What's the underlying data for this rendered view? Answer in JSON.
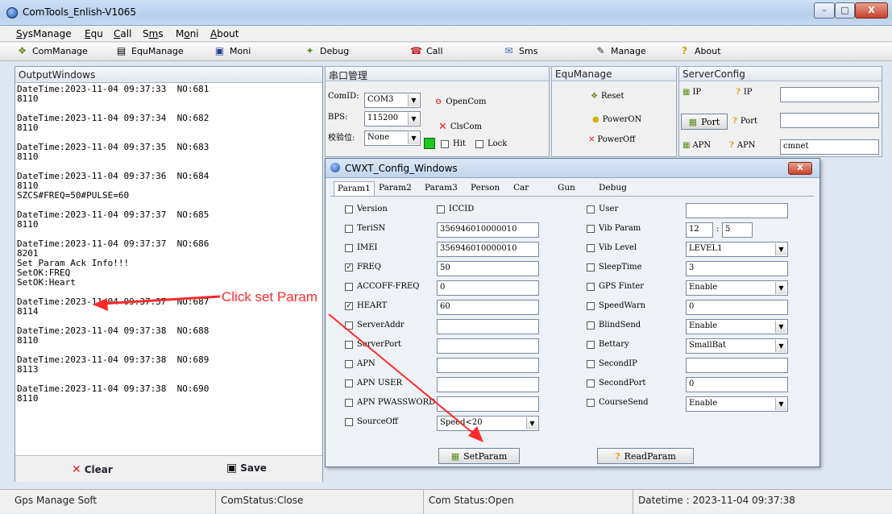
{
  "window": {
    "title": "ComTools_Enlish-V1065",
    "min": "–",
    "max": "□",
    "close": "X"
  },
  "menu": [
    {
      "pre": "",
      "u": "S",
      "post": "ysManage"
    },
    {
      "pre": "",
      "u": "E",
      "post": "qu"
    },
    {
      "pre": "",
      "u": "C",
      "post": "all"
    },
    {
      "pre": "S",
      "u": "m",
      "post": "s"
    },
    {
      "pre": "M",
      "u": "o",
      "post": "ni"
    },
    {
      "pre": "",
      "u": "A",
      "post": "bout"
    }
  ],
  "toolbar": {
    "items": [
      {
        "label": "ComManage",
        "icon": "manage-icon"
      },
      {
        "label": "EquManage",
        "icon": "document-icon"
      },
      {
        "label": "Moni",
        "icon": "monitor-icon"
      },
      {
        "label": "Debug",
        "icon": "debug-icon"
      },
      {
        "label": "Call",
        "icon": "phone-icon"
      },
      {
        "label": "Sms",
        "icon": "sms-icon"
      },
      {
        "label": "Manage",
        "icon": "settings-icon"
      },
      {
        "label": "About",
        "icon": "help-icon"
      }
    ]
  },
  "output": {
    "title": "OutputWindows",
    "lines": [
      "DateTime:2023-11-04 09:37:33  NO:681",
      "8110",
      "",
      "DateTime:2023-11-04 09:37:34  NO:682",
      "8110",
      "",
      "DateTime:2023-11-04 09:37:35  NO:683",
      "8110",
      "",
      "DateTime:2023-11-04 09:37:36  NO:684",
      "8110",
      "SZCS#FREQ=50#PULSE=60",
      "",
      "DateTime:2023-11-04 09:37:37  NO:685",
      "8110",
      "",
      "DateTime:2023-11-04 09:37:37  NO:686",
      "8201",
      "Set Param Ack Info!!!",
      "SetOK:FREQ",
      "SetOK:Heart",
      "",
      "DateTime:2023-11-04 09:37:37  NO:687",
      "8114",
      "",
      "DateTime:2023-11-04 09:37:38  NO:688",
      "8110",
      "",
      "DateTime:2023-11-04 09:37:38  NO:689",
      "8113",
      "",
      "DateTime:2023-11-04 09:37:38  NO:690",
      "8110"
    ],
    "clear": "Clear",
    "save": "Save"
  },
  "serial": {
    "title": "串口管理",
    "comid_label": "ComID:",
    "comid": "COM3",
    "bps_label": "BPS:",
    "bps": "115200",
    "check_label": "校验位:",
    "check": "None",
    "open": "OpenCom",
    "close": "ClsCom",
    "hit": "Hit",
    "lock": "Lock"
  },
  "equ": {
    "title": "EquManage",
    "reset": "Reset",
    "poweron": "PowerON",
    "poweroff": "PowerOff"
  },
  "server": {
    "title": "ServerConfig",
    "ip_btn": "IP",
    "ip_label": "IP",
    "ip_value": "",
    "port_btn": "Port",
    "port_label": "Port",
    "port_value": "",
    "apn_btn": "APN",
    "apn_label": "APN",
    "apn_value": "cmnet"
  },
  "dialog": {
    "title": "CWXT_Config_Windows",
    "tabs": [
      "Param1",
      "Param2",
      "Param3",
      "Person",
      "Car",
      "Gun",
      "Debug"
    ],
    "left": [
      {
        "label": "Version",
        "checked": false,
        "value": "",
        "kind": "check"
      },
      {
        "label": "TeriSN",
        "checked": false,
        "value": "356946010000010",
        "kind": "text"
      },
      {
        "label": "IMEI",
        "checked": false,
        "value": "356946010000010",
        "kind": "text"
      },
      {
        "label": "FREQ",
        "checked": true,
        "value": "50",
        "kind": "text"
      },
      {
        "label": "ACCOFF-FREQ",
        "checked": false,
        "value": "0",
        "kind": "text"
      },
      {
        "label": "HEART",
        "checked": true,
        "value": "60",
        "kind": "text"
      },
      {
        "label": "ServerAddr",
        "checked": false,
        "value": "",
        "kind": "text"
      },
      {
        "label": "ServerPort",
        "checked": false,
        "value": "",
        "kind": "text"
      },
      {
        "label": "APN",
        "checked": false,
        "value": "",
        "kind": "text"
      },
      {
        "label": "APN USER",
        "checked": false,
        "value": "",
        "kind": "text"
      },
      {
        "label": "APN PWASSWORD",
        "checked": false,
        "value": "",
        "kind": "text"
      },
      {
        "label": "SourceOff",
        "checked": false,
        "value": "Speed<20",
        "kind": "combo"
      }
    ],
    "iccid": "ICCID",
    "right": [
      {
        "label": "User",
        "value": "",
        "kind": "text"
      },
      {
        "label": "Vib Param",
        "value": "",
        "kind": "vib"
      },
      {
        "label": "Vib Level",
        "value": "LEVEL1",
        "kind": "combo"
      },
      {
        "label": "SleepTime",
        "value": "3",
        "kind": "text"
      },
      {
        "label": "GPS Finter",
        "value": "Enable",
        "kind": "combo"
      },
      {
        "label": "SpeedWarn",
        "value": "0",
        "kind": "text"
      },
      {
        "label": "BlindSend",
        "value": "Enable",
        "kind": "combo"
      },
      {
        "label": "Bettary",
        "value": "SmallBat",
        "kind": "combo"
      },
      {
        "label": "SecondIP",
        "value": "",
        "kind": "text"
      },
      {
        "label": "SecondPort",
        "value": "0",
        "kind": "text"
      },
      {
        "label": "CourseSend",
        "value": "Enable",
        "kind": "combo"
      }
    ],
    "vib1": "12",
    "vib2": "5",
    "set_param": "SetParam",
    "read_param": "ReadParam"
  },
  "status": {
    "soft": "Gps Manage Soft",
    "com1": "ComStatus:Close",
    "com2": "Com Status:Open",
    "datetime": "Datetime : 2023-11-04 09:37:38"
  },
  "annotation": {
    "text": "Click set Param",
    "color": "#ff2a2a"
  }
}
